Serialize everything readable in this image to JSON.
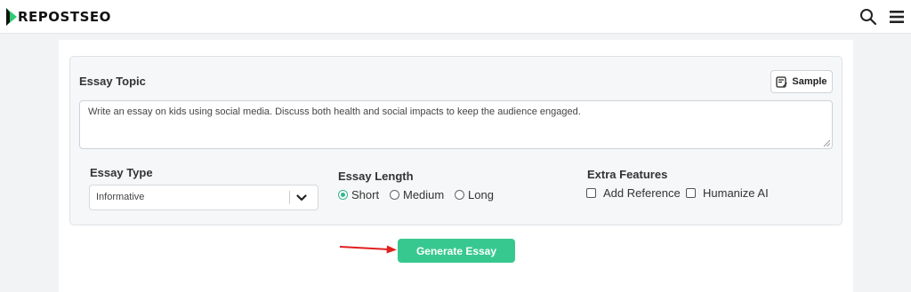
{
  "header": {
    "logo_text": "REPOSTSEO",
    "icons": {
      "search": "search-icon",
      "menu": "hamburger-menu-icon"
    }
  },
  "form": {
    "topic_label": "Essay Topic",
    "sample_label": "Sample",
    "topic_value": "Write an essay on kids using social media. Discuss both health and social impacts to keep the audience engaged.",
    "essay_type": {
      "label": "Essay Type",
      "selected": "Informative"
    },
    "essay_length": {
      "label": "Essay Length",
      "options": [
        "Short",
        "Medium",
        "Long"
      ],
      "selected": "Short"
    },
    "extra_features": {
      "label": "Extra Features",
      "options": [
        "Add Reference",
        "Humanize AI"
      ]
    },
    "generate_label": "Generate Essay"
  },
  "colors": {
    "accent": "#37c890",
    "annotation_arrow": "#e02020"
  }
}
